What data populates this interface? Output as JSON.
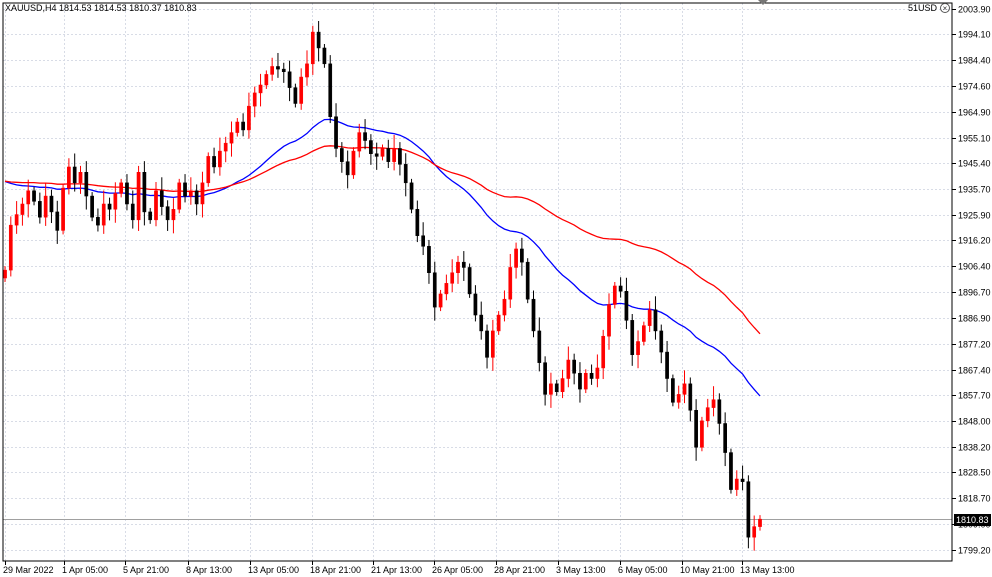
{
  "chart": {
    "symbol_line": "XAUUSD,H4  1814.53 1814.53 1810.37 1810.83",
    "right_label": "51USD",
    "current_price_label": "1810.83"
  },
  "chart_data": {
    "type": "candlestick",
    "title": "XAUUSD,H4",
    "ohlc_header": {
      "open": 1814.53,
      "high": 1814.53,
      "low": 1810.37,
      "close": 1810.83
    },
    "ylim": [
      1795.0,
      2006.0
    ],
    "y_ticks": [
      2003.9,
      1994.1,
      1984.4,
      1974.6,
      1964.9,
      1955.1,
      1945.4,
      1935.7,
      1925.9,
      1916.2,
      1906.4,
      1896.7,
      1886.9,
      1877.2,
      1867.4,
      1857.7,
      1848.0,
      1838.2,
      1828.5,
      1818.7,
      1809.0,
      1799.2
    ],
    "x_tick_labels": [
      "29 Mar 2022",
      "1 Apr 05:00",
      "5 Apr 21:00",
      "8 Apr 13:00",
      "13 Apr 05:00",
      "18 Apr 21:00",
      "21 Apr 13:00",
      "26 Apr 05:00",
      "28 Apr 21:00",
      "3 May 13:00",
      "6 May 05:00",
      "10 May 21:00",
      "13 May 13:00"
    ],
    "current_price": 1810.83,
    "bull_color": "#ff0000",
    "bear_color": "#000000",
    "grid": true,
    "candle_count": 126,
    "closes": [
      1905.0,
      1922.0,
      1926.0,
      1930.0,
      1935.0,
      1931.0,
      1925.0,
      1933.0,
      1927.0,
      1920.0,
      1936.0,
      1944.0,
      1938.0,
      1942.0,
      1933.0,
      1925.0,
      1922.0,
      1930.0,
      1928.0,
      1934.0,
      1938.0,
      1930.0,
      1924.0,
      1942.0,
      1927.0,
      1924.0,
      1935.0,
      1929.0,
      1924.0,
      1928.0,
      1938.0,
      1933.0,
      1935.0,
      1930.0,
      1938.0,
      1948.0,
      1944.0,
      1950.0,
      1953.0,
      1957.0,
      1961.0,
      1958.0,
      1967.0,
      1972.0,
      1975.0,
      1979.0,
      1982.0,
      1981.0,
      1980.0,
      1974.0,
      1968.0,
      1978.0,
      1983.0,
      1995.0,
      1989.0,
      1983.0,
      1963.0,
      1951.0,
      1946.0,
      1941.0,
      1950.0,
      1957.0,
      1954.0,
      1949.0,
      1948.0,
      1951.0,
      1946.0,
      1951.0,
      1945.0,
      1938.0,
      1928.0,
      1918.0,
      1914.0,
      1904.0,
      1891.0,
      1896.0,
      1900.0,
      1904.0,
      1908.0,
      1906.0,
      1896.0,
      1888.0,
      1882.0,
      1872.0,
      1882.0,
      1888.0,
      1894.0,
      1906.0,
      1913.0,
      1908.0,
      1894.0,
      1882.0,
      1870.0,
      1858.0,
      1862.0,
      1859.0,
      1864.0,
      1871.0,
      1866.0,
      1860.0,
      1866.0,
      1864.0,
      1868.0,
      1880.0,
      1892.0,
      1899.0,
      1897.0,
      1886.0,
      1873.0,
      1878.0,
      1884.0,
      1890.0,
      1882.0,
      1874.0,
      1864.0,
      1855.0,
      1858.0,
      1862.0,
      1852.0,
      1838.0,
      1848.0,
      1853.0,
      1856.0,
      1847.0,
      1836.0,
      1822.0,
      1826.0,
      1825.0,
      1804.0,
      1808.0,
      1810.83
    ],
    "series": [
      {
        "name": "",
        "color": "#0000ff",
        "values": [
          1938.5,
          1937.8,
          1937.2,
          1936.9,
          1936.8,
          1936.6,
          1936.3,
          1936.3,
          1936.1,
          1935.6,
          1935.6,
          1935.9,
          1935.9,
          1936.0,
          1935.8,
          1935.2,
          1934.6,
          1934.4,
          1934.1,
          1934.1,
          1934.2,
          1934.0,
          1933.5,
          1933.9,
          1933.6,
          1933.2,
          1933.3,
          1933.1,
          1932.7,
          1932.5,
          1932.8,
          1932.8,
          1932.9,
          1932.8,
          1933.1,
          1933.8,
          1934.3,
          1935.1,
          1936.0,
          1937.1,
          1938.4,
          1939.4,
          1940.8,
          1942.5,
          1944.3,
          1946.3,
          1948.3,
          1950.1,
          1951.8,
          1953.0,
          1953.8,
          1955.1,
          1956.7,
          1958.9,
          1960.6,
          1961.9,
          1962.0,
          1961.4,
          1960.6,
          1959.6,
          1959.1,
          1959.0,
          1958.8,
          1958.3,
          1957.8,
          1957.5,
          1956.9,
          1956.6,
          1956.0,
          1955.0,
          1953.6,
          1951.9,
          1950.0,
          1947.8,
          1944.9,
          1942.5,
          1940.4,
          1938.7,
          1937.2,
          1935.6,
          1933.6,
          1931.2,
          1928.7,
          1925.8,
          1923.6,
          1921.8,
          1920.5,
          1919.8,
          1919.5,
          1918.9,
          1917.6,
          1915.7,
          1913.4,
          1910.4,
          1907.9,
          1905.3,
          1903.1,
          1901.4,
          1899.4,
          1897.2,
          1895.5,
          1893.8,
          1892.4,
          1891.8,
          1891.9,
          1892.2,
          1892.4,
          1892.1,
          1891.1,
          1890.5,
          1890.2,
          1890.2,
          1889.8,
          1889.0,
          1887.8,
          1886.1,
          1884.6,
          1883.5,
          1881.9,
          1879.6,
          1878.1,
          1876.8,
          1875.8,
          1874.3,
          1872.4,
          1869.8,
          1867.7,
          1865.7,
          1862.5,
          1859.9,
          1857.4
        ]
      },
      {
        "name": "",
        "color": "#ff0000",
        "values": [
          1938.6,
          1938.3,
          1938.2,
          1938.1,
          1938.1,
          1938.1,
          1937.9,
          1937.9,
          1937.8,
          1937.5,
          1937.5,
          1937.6,
          1937.6,
          1937.6,
          1937.5,
          1937.2,
          1936.9,
          1936.7,
          1936.5,
          1936.4,
          1936.4,
          1936.2,
          1935.9,
          1936.0,
          1935.8,
          1935.5,
          1935.5,
          1935.3,
          1935.0,
          1934.8,
          1934.9,
          1934.8,
          1934.8,
          1934.7,
          1934.8,
          1935.2,
          1935.5,
          1935.9,
          1936.4,
          1937.1,
          1937.8,
          1938.4,
          1939.2,
          1940.2,
          1941.3,
          1942.4,
          1943.6,
          1944.7,
          1945.7,
          1946.5,
          1947.0,
          1947.8,
          1948.8,
          1950.0,
          1951.0,
          1951.8,
          1952.0,
          1951.9,
          1951.6,
          1951.2,
          1951.1,
          1951.3,
          1951.4,
          1951.3,
          1951.2,
          1951.2,
          1951.0,
          1951.0,
          1950.8,
          1950.3,
          1949.5,
          1948.6,
          1947.6,
          1946.4,
          1944.8,
          1943.6,
          1942.6,
          1941.8,
          1941.2,
          1940.5,
          1939.6,
          1938.4,
          1937.1,
          1935.5,
          1934.4,
          1933.5,
          1932.8,
          1932.6,
          1932.7,
          1932.5,
          1931.9,
          1930.9,
          1929.7,
          1928.1,
          1926.7,
          1925.3,
          1924.1,
          1923.1,
          1922.0,
          1920.6,
          1919.5,
          1918.5,
          1917.6,
          1917.0,
          1916.8,
          1916.7,
          1916.6,
          1916.1,
          1915.1,
          1914.3,
          1913.8,
          1913.4,
          1912.8,
          1911.9,
          1910.7,
          1909.3,
          1907.9,
          1906.8,
          1905.4,
          1903.4,
          1901.8,
          1900.4,
          1899.2,
          1897.5,
          1895.5,
          1893.1,
          1890.9,
          1888.8,
          1885.8,
          1883.3,
          1880.9
        ]
      }
    ]
  }
}
